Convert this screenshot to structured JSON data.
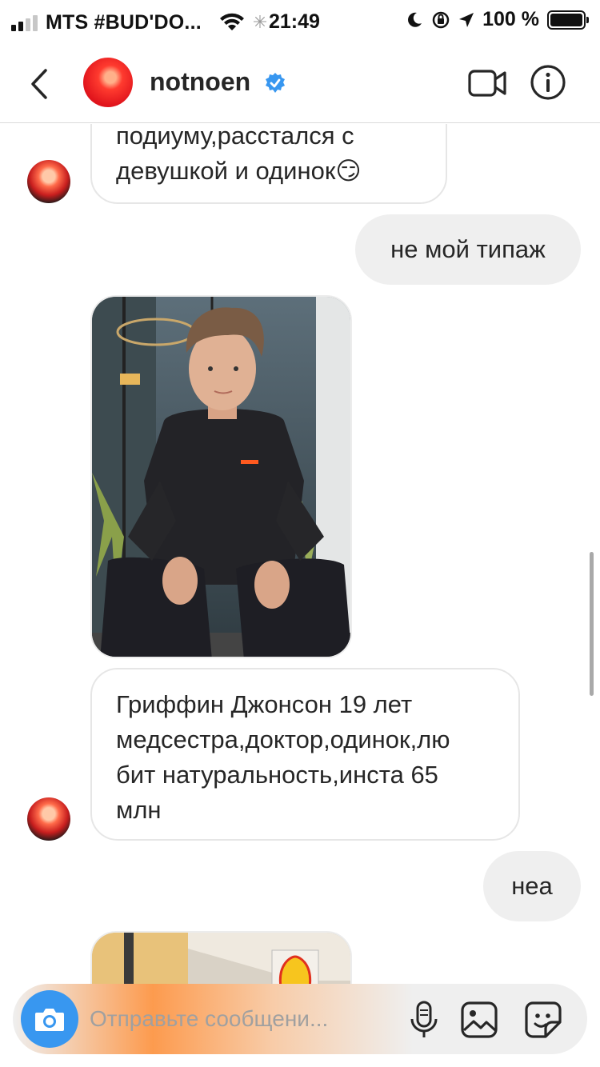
{
  "status": {
    "carrier": "MTS #BUD'DO...",
    "time": "21:49",
    "battery": "100 %",
    "battery_level": 1.0
  },
  "header": {
    "username": "notnoen"
  },
  "messages": {
    "m1_line1": "подиуму,расстался с",
    "m1_line2": "девушкой и одинок😏",
    "m2": "не мой типаж",
    "m3_line1": "Гриффин Джонсон 19 лет",
    "m3_line2": "медсестра,доктор,одинок,лю",
    "m3_line3": "бит натуральность,инста 65",
    "m3_line4": "млн",
    "m4": "неа"
  },
  "composer": {
    "placeholder": "Отправьте сообщени..."
  },
  "colors": {
    "accent": "#3897f0",
    "verified": "#3897f0",
    "bubble_out": "#efefef",
    "bubble_in_border": "#e6e6e6"
  },
  "icons": {
    "back": "chevron-left-icon",
    "video": "video-camera-icon",
    "info": "info-icon",
    "camera": "camera-icon",
    "mic": "microphone-icon",
    "gallery": "gallery-icon",
    "sticker": "sticker-icon"
  }
}
